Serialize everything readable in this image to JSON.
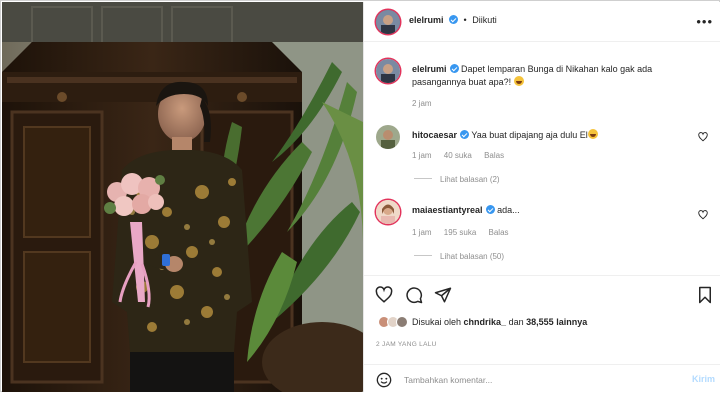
{
  "post": {
    "username": "elelrumi",
    "follow_status": "Diikuti",
    "more": "•••"
  },
  "caption": {
    "username": "elelrumi",
    "text": "Dapet lemparan Bunga di Nikahan kalo gak ada pasangannya buat apa?!",
    "time": "2 jam"
  },
  "comments": [
    {
      "username": "hitocaesar",
      "text": "Yaa buat dipajang aja dulu El",
      "time": "1 jam",
      "likes": "40 suka",
      "reply": "Balas",
      "view_replies": "Lihat balasan (2)"
    },
    {
      "username": "maiaestiantyreal",
      "text": "ada...",
      "time": "1 jam",
      "likes": "195 suka",
      "reply": "Balas",
      "view_replies": "Lihat balasan (50)"
    }
  ],
  "likes": {
    "prefix": "Disukai oleh",
    "user": "chndrika_",
    "middle": "dan",
    "count": "38,555",
    "suffix": "lainnya"
  },
  "timestamp": "2 JAM YANG LALU",
  "add_comment": {
    "placeholder": "Tambahkan komentar...",
    "post_label": "Kirim"
  },
  "icons": [
    "heart-icon",
    "comment-icon",
    "share-icon",
    "bookmark-icon",
    "emoji-icon",
    "verified-icon",
    "more-icon"
  ],
  "colors": {
    "accent": "#3897f0",
    "muted": "#8e8e8e",
    "post_button": "#b3dbff"
  }
}
